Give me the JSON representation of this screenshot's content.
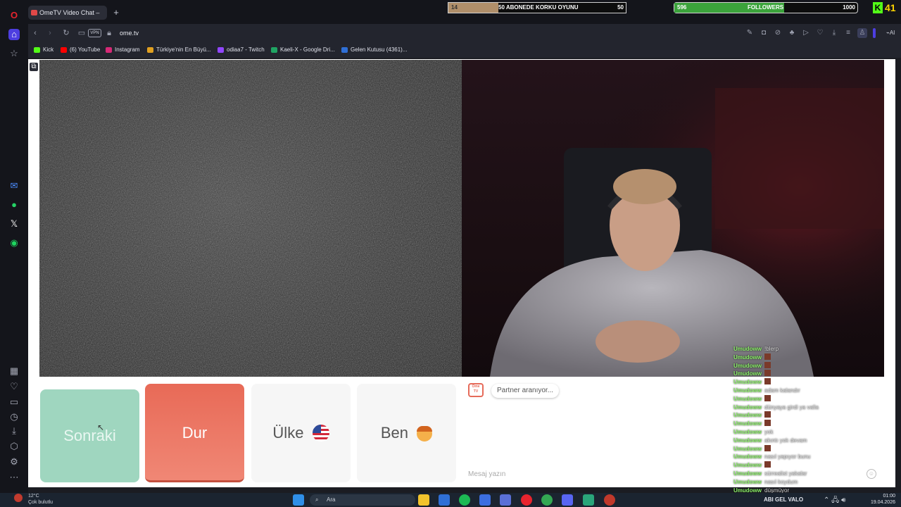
{
  "browser": {
    "tab_title": "OmeTV Video Chat –",
    "url": "ome.tv",
    "vpn_label": "VPN",
    "bookmarks": [
      {
        "label": "Kick",
        "color": "#53fc18"
      },
      {
        "label": "(6) YouTube",
        "color": "#ff0000"
      },
      {
        "label": "Instagram",
        "color": "#d62976"
      },
      {
        "label": "Türkiye'nin En Büyü...",
        "color": "#e0a020"
      },
      {
        "label": "odiaa7 - Twitch",
        "color": "#9146ff"
      },
      {
        "label": "Kaeli-X - Google Dri...",
        "color": "#1fa463"
      },
      {
        "label": "Gelen Kutusu (4361)...",
        "color": "#2f6fd6"
      }
    ],
    "ai_label": "AI"
  },
  "overlays": {
    "sub_goal": {
      "current": "14",
      "label": "50 ABONEDE KORKU OYUNU",
      "target": "50",
      "progress": 0.28
    },
    "follower_goal": {
      "current": "596",
      "label": "FOLLOWERS",
      "target": "1000",
      "progress": 0.6
    },
    "kick_count": "41"
  },
  "controls": {
    "next_label": "Sonraki",
    "stop_label": "Dur",
    "country_label": "Ülke",
    "gender_label": "Ben"
  },
  "chat": {
    "status": "Partner aranıyor...",
    "placeholder": "Mesaj yazın",
    "logo_text": "Ome TV"
  },
  "stream_chat": [
    {
      "user": "Umudoww",
      "text": "!blerp",
      "emote": false
    },
    {
      "user": "Umudoww",
      "text": "",
      "emote": true
    },
    {
      "user": "Umudoww",
      "text": "",
      "emote": true
    },
    {
      "user": "Umudoww",
      "text": "",
      "emote": true
    },
    {
      "user": "Umudoww",
      "text": "",
      "emote": true
    },
    {
      "user": "Umudoww",
      "text": "adam kalandır",
      "emote": false
    },
    {
      "user": "Umudoww",
      "text": "",
      "emote": true
    },
    {
      "user": "Umudoww",
      "text": "dünyaya girdi ya valla",
      "emote": false
    },
    {
      "user": "Umudoww",
      "text": "",
      "emote": true
    },
    {
      "user": "Umudoww",
      "text": "",
      "emote": true
    },
    {
      "user": "Umudoww",
      "text": "yok",
      "emote": false
    },
    {
      "user": "Umudoww",
      "text": "akıntı yok devam",
      "emote": false
    },
    {
      "user": "Umudoww",
      "text": "",
      "emote": true
    },
    {
      "user": "Umudoww",
      "text": "nasıl yapıyor bunu",
      "emote": false
    },
    {
      "user": "Umudoww",
      "text": "",
      "emote": true
    },
    {
      "user": "Umudoww",
      "text": "sürrealist yakalar",
      "emote": false
    },
    {
      "user": "Umudoww",
      "text": "nasıl koydum",
      "emote": false
    },
    {
      "user": "Umudoww",
      "text": "düşmüyor",
      "emote": false
    }
  ],
  "taskbar": {
    "weather_temp": "12°C",
    "weather_desc": "Çok bulutlu",
    "search_placeholder": "Ara",
    "now_playing": "ABI GEL VALO",
    "time": "01:00",
    "date": "19.04.2026"
  }
}
